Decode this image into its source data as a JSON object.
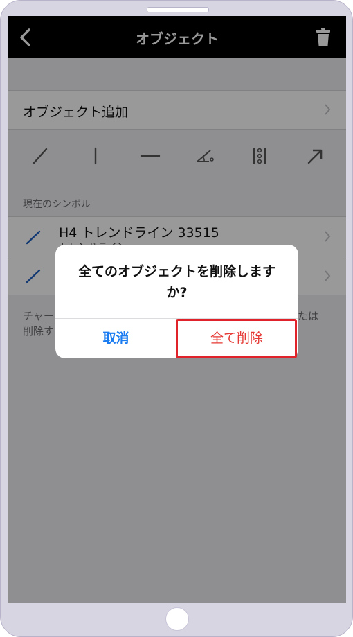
{
  "navbar": {
    "title": "オブジェクト",
    "back_icon": "chevron-left-icon",
    "trash_icon": "trash-icon"
  },
  "add_object": {
    "label": "オブジェクト追加"
  },
  "tools": [
    {
      "name": "trendline-tool",
      "icon": "diagonal-line-icon"
    },
    {
      "name": "vertical-line-tool",
      "icon": "vertical-line-icon"
    },
    {
      "name": "horizontal-line-tool",
      "icon": "horizontal-line-icon"
    },
    {
      "name": "angle-tool",
      "icon": "angle-icon"
    },
    {
      "name": "fibonacci-tool",
      "icon": "dots-column-icon"
    },
    {
      "name": "arrow-tool",
      "icon": "arrow-up-right-icon"
    }
  ],
  "section": {
    "current_symbol_label": "現在のシンボル"
  },
  "symbols": [
    {
      "title": "H4 トレンドライン 33515",
      "subtitle": "トレンドライン"
    },
    {
      "title": "",
      "subtitle": ""
    }
  ],
  "footer": {
    "line1_start": "チャー",
    "line1_end": "たは",
    "line2_start": "削除す"
  },
  "alert": {
    "message": "全てのオブジェクトを削除しますか?",
    "cancel_label": "取消",
    "delete_label": "全て削除"
  },
  "colors": {
    "accent_blue": "#1a7cf0",
    "destructive_red": "#e53935",
    "highlight_red": "#e0222a",
    "navbar_bg": "#000000"
  }
}
